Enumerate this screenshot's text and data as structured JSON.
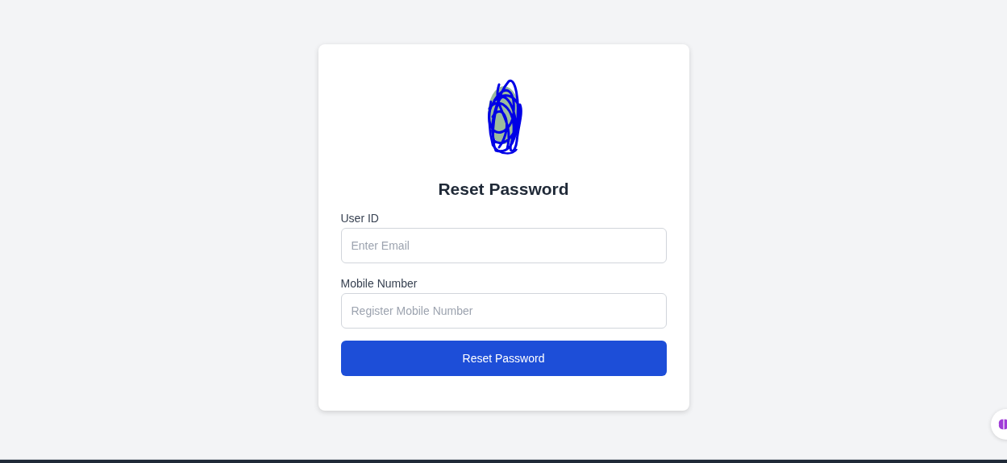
{
  "card": {
    "title": "Reset Password"
  },
  "fields": [
    {
      "label": "User ID",
      "placeholder": "Enter Email"
    },
    {
      "label": "Mobile Number",
      "placeholder": "Register Mobile Number"
    }
  ],
  "button": {
    "label": "Reset Password"
  }
}
